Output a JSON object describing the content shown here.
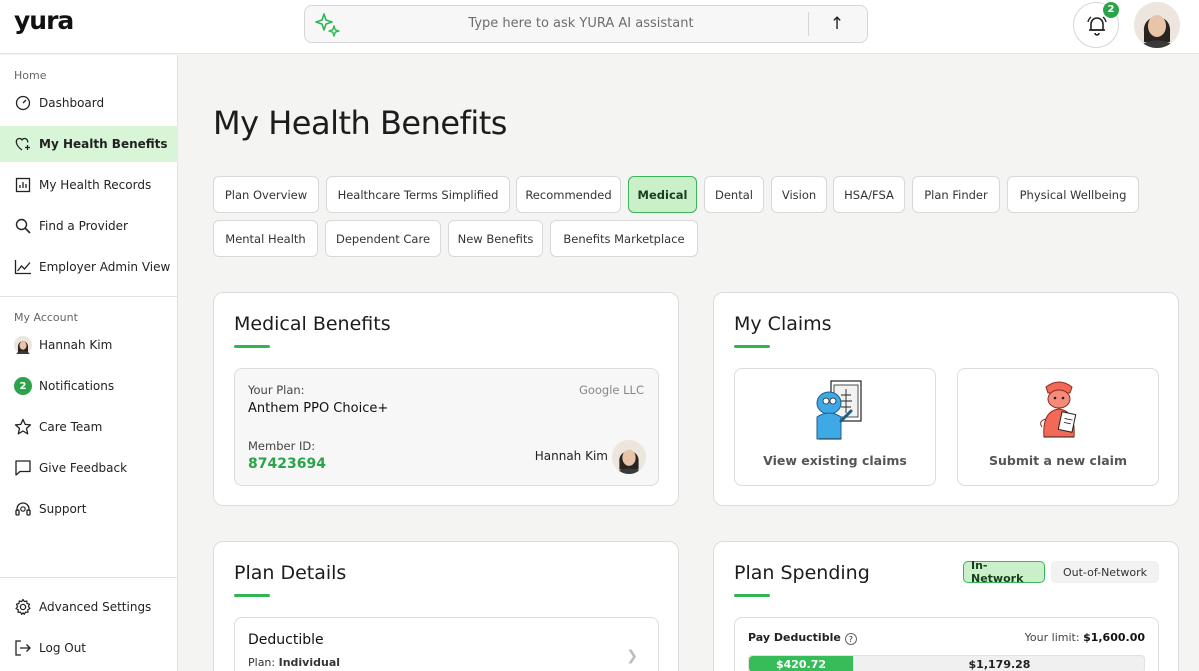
{
  "brand": {
    "logo": "yura"
  },
  "search": {
    "placeholder": "Type here to ask YURA AI assistant",
    "send_icon": "arrow-up-icon"
  },
  "header": {
    "notification_count": "2"
  },
  "sidebar": {
    "sections": {
      "home": "Home",
      "account": "My Account"
    },
    "home_items": [
      {
        "label": "Dashboard",
        "icon": "dashboard-gauge-icon"
      },
      {
        "label": "My Health Benefits",
        "icon": "heart-plus-icon"
      },
      {
        "label": "My Health Records",
        "icon": "bar-chart-icon"
      },
      {
        "label": "Find a Provider",
        "icon": "search-icon"
      },
      {
        "label": "Employer Admin View",
        "icon": "line-chart-icon"
      }
    ],
    "account_items": [
      {
        "label": "Hannah Kim",
        "icon": "avatar"
      },
      {
        "label": "Notifications",
        "badge": "2"
      },
      {
        "label": "Care Team",
        "icon": "star-icon"
      },
      {
        "label": "Give Feedback",
        "icon": "chat-icon"
      },
      {
        "label": "Support",
        "icon": "headset-icon"
      }
    ],
    "bottom_items": [
      {
        "label": "Advanced Settings",
        "icon": "gear-icon"
      },
      {
        "label": "Log Out",
        "icon": "logout-icon"
      }
    ]
  },
  "main": {
    "title": "My Health Benefits",
    "tabs": [
      "Plan Overview",
      "Healthcare Terms Simplified",
      "Recommended",
      "Medical",
      "Dental",
      "Vision",
      "HSA/FSA",
      "Plan Finder",
      "Physical Wellbeing",
      "Mental Health",
      "Dependent Care",
      "New Benefits",
      "Benefits Marketplace"
    ],
    "active_tab": "Medical"
  },
  "medical_benefits": {
    "title": "Medical Benefits",
    "your_plan_label": "Your Plan:",
    "plan_name": "Anthem PPO Choice+",
    "company": "Google LLC",
    "member_id_label": "Member ID:",
    "member_id": "87423694",
    "member_name": "Hannah Kim"
  },
  "my_claims": {
    "title": "My Claims",
    "view_label": "View existing claims",
    "submit_label": "Submit a new claim"
  },
  "plan_details": {
    "title": "Plan Details",
    "deductible_title": "Deductible",
    "plan_prefix": "Plan:",
    "plan_type": "Individual"
  },
  "plan_spending": {
    "title": "Plan Spending",
    "toggle_in": "In-Network",
    "toggle_out": "Out-of-Network",
    "pay_deductible_label": "Pay Deductible",
    "help_icon": "?",
    "limit_prefix": "Your limit:",
    "limit_value": "$1,600.00",
    "used_value": "$420.72",
    "remaining_value": "$1,179.28",
    "used_fraction": 0.263
  },
  "colors": {
    "accent": "#2fb553",
    "active_bg": "#d8f5d8",
    "badge": "#2aa44a"
  }
}
